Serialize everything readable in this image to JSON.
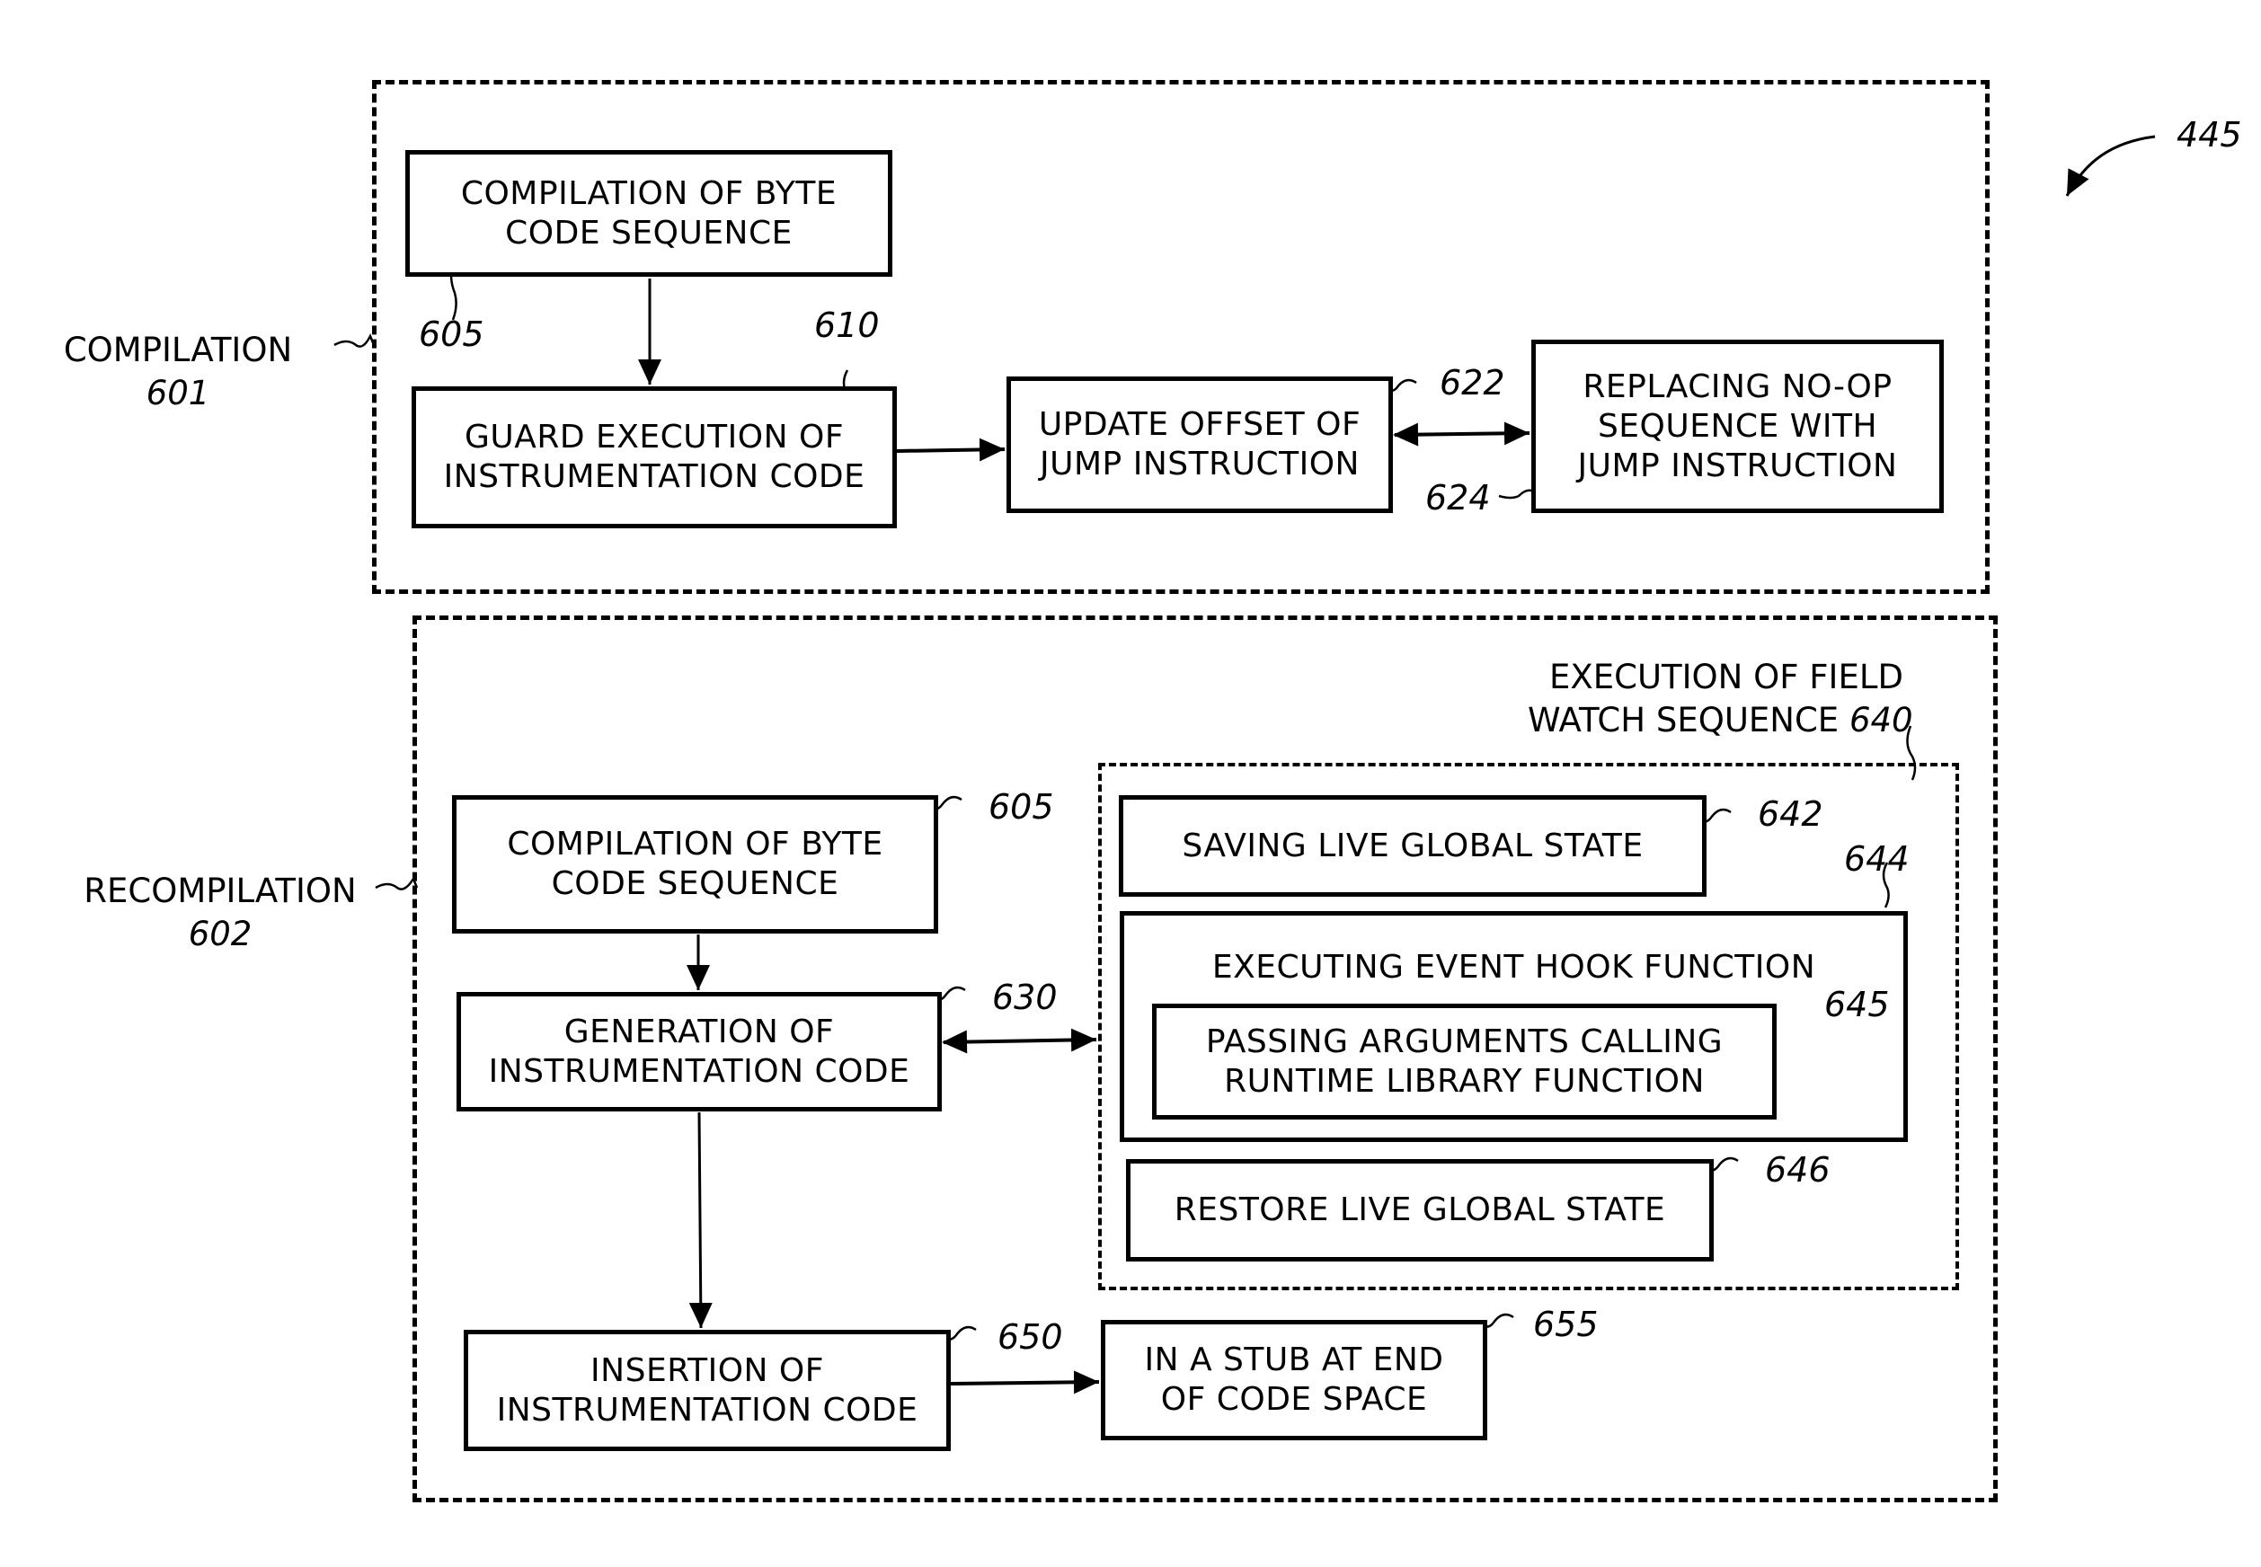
{
  "figure": {
    "ref": "445",
    "sections": {
      "compilation": {
        "label": "COMPILATION",
        "ref": "601"
      },
      "recompilation": {
        "label": "RECOMPILATION",
        "ref": "602"
      }
    },
    "field_watch": {
      "label_line1": "EXECUTION OF FIELD",
      "label_line2": "WATCH SEQUENCE",
      "ref": "640"
    },
    "boxes": {
      "b605a": {
        "text": "COMPILATION OF BYTE\nCODE SEQUENCE",
        "ref": "605"
      },
      "b610": {
        "text": "GUARD EXECUTION OF\nINSTRUMENTATION CODE",
        "ref": "610"
      },
      "b622": {
        "text": "UPDATE OFFSET OF\nJUMP INSTRUCTION",
        "ref": "622"
      },
      "b624": {
        "text": "REPLACING NO-OP\nSEQUENCE WITH\nJUMP INSTRUCTION",
        "ref": "624"
      },
      "b605b": {
        "text": "COMPILATION OF BYTE\nCODE SEQUENCE",
        "ref": "605"
      },
      "b630": {
        "text": "GENERATION OF\nINSTRUMENTATION CODE",
        "ref": "630"
      },
      "b642": {
        "text": "SAVING LIVE GLOBAL STATE",
        "ref": "642"
      },
      "b644": {
        "text": "EXECUTING EVENT HOOK FUNCTION",
        "ref": "644"
      },
      "b645": {
        "text": "PASSING ARGUMENTS CALLING\nRUNTIME LIBRARY FUNCTION",
        "ref": "645"
      },
      "b646": {
        "text": "RESTORE LIVE GLOBAL STATE",
        "ref": "646"
      },
      "b650": {
        "text": "INSERTION OF\nINSTRUMENTATION CODE",
        "ref": "650"
      },
      "b655": {
        "text": "IN A STUB AT END\nOF CODE SPACE",
        "ref": "655"
      }
    },
    "connections": [
      {
        "from": "605",
        "to": "610",
        "type": "arrow"
      },
      {
        "from": "610",
        "to": "622",
        "type": "arrow"
      },
      {
        "from": "622",
        "to": "624",
        "type": "bidirectional"
      },
      {
        "from": "605",
        "to": "630",
        "type": "arrow"
      },
      {
        "from": "630",
        "to": "640",
        "type": "bidirectional"
      },
      {
        "from": "630",
        "to": "650",
        "type": "arrow"
      },
      {
        "from": "650",
        "to": "655",
        "type": "arrow"
      }
    ]
  }
}
